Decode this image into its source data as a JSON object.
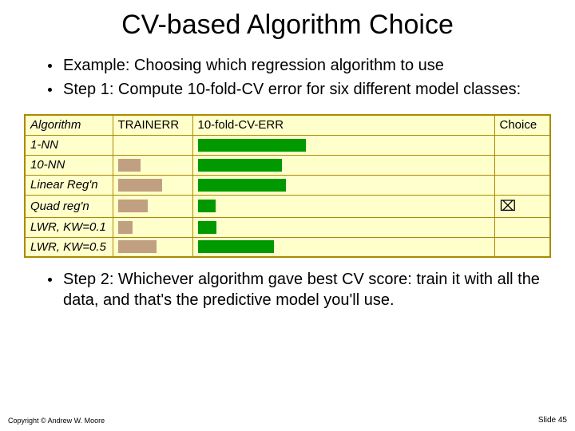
{
  "title": "CV-based Algorithm Choice",
  "bullets": {
    "b1": "Example: Choosing which regression algorithm to use",
    "b2": "Step 1: Compute 10-fold-CV error for six different model classes:"
  },
  "table": {
    "headers": {
      "alg": "Algorithm",
      "train": "TRAINERR",
      "cv": "10-fold-CV-ERR",
      "choice": "Choice"
    },
    "rows": [
      {
        "alg": "1-NN",
        "train_bar": 0,
        "cv_bar": 135,
        "choice": ""
      },
      {
        "alg": "10-NN",
        "train_bar": 28,
        "cv_bar": 105,
        "choice": ""
      },
      {
        "alg": "Linear Reg'n",
        "train_bar": 55,
        "cv_bar": 110,
        "choice": ""
      },
      {
        "alg": "Quad reg'n",
        "train_bar": 37,
        "cv_bar": 22,
        "choice": "⌧"
      },
      {
        "alg": "LWR, KW=0.1",
        "train_bar": 18,
        "cv_bar": 23,
        "choice": ""
      },
      {
        "alg": "LWR, KW=0.5",
        "train_bar": 48,
        "cv_bar": 95,
        "choice": ""
      }
    ]
  },
  "step2": "Step 2: Whichever algorithm gave best CV score: train it with all the data, and that's the predictive model you'll use.",
  "footer": {
    "left": "Copyright © Andrew W. Moore",
    "right": "Slide 45"
  },
  "chart_data": {
    "type": "table",
    "title": "CV-based Algorithm Choice — TRAINERR vs 10-fold-CV-ERR (relative bar lengths)",
    "columns": [
      "Algorithm",
      "TRAINERR (relative)",
      "10-fold-CV-ERR (relative)",
      "Choice"
    ],
    "rows": [
      [
        "1-NN",
        0,
        135,
        ""
      ],
      [
        "10-NN",
        28,
        105,
        ""
      ],
      [
        "Linear Reg'n",
        55,
        110,
        ""
      ],
      [
        "Quad reg'n",
        37,
        22,
        "selected"
      ],
      [
        "LWR, KW=0.1",
        18,
        23,
        ""
      ],
      [
        "LWR, KW=0.5",
        48,
        95,
        ""
      ]
    ],
    "note": "Bar lengths are relative pixel widths estimated from the slide; no numeric axis is shown."
  }
}
